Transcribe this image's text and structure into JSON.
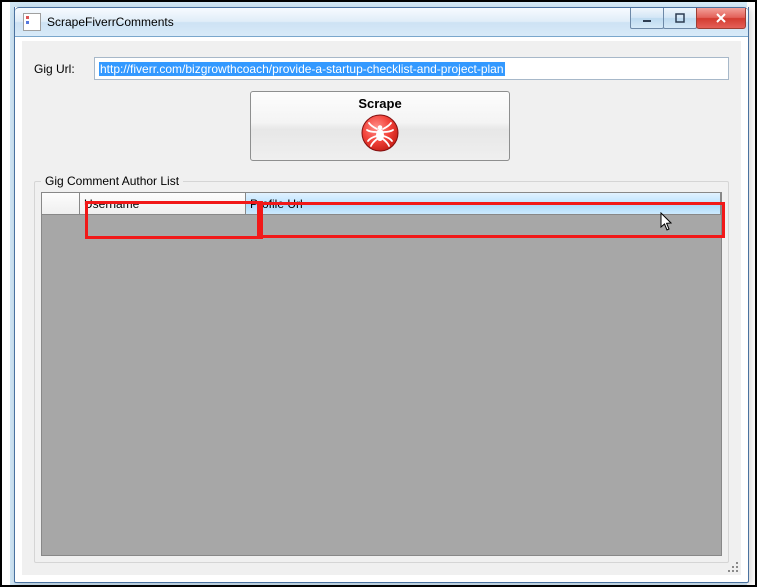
{
  "window": {
    "title": "ScrapeFiverrComments"
  },
  "controls": {
    "minimize_glyph": "min",
    "maximize_glyph": "max",
    "close_glyph": "close"
  },
  "url": {
    "label": "Gig Url:",
    "value": "http://fiverr.com/bizgrowthcoach/provide-a-startup-checklist-and-project-plan"
  },
  "scrape": {
    "label": "Scrape"
  },
  "group": {
    "label": "Gig Comment Author List"
  },
  "grid": {
    "columns": {
      "username": "Username",
      "profile_url": "Profile Url"
    },
    "rows": []
  }
}
